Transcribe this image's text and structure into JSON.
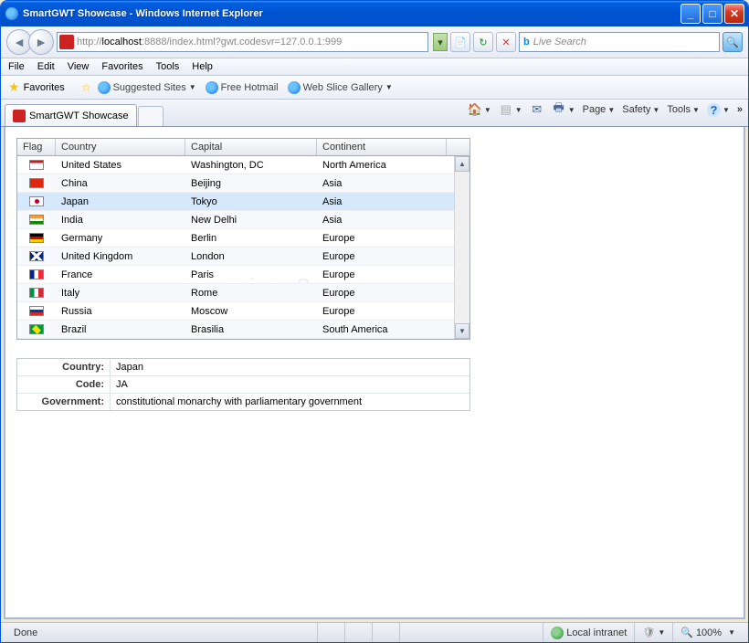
{
  "window": {
    "title": "SmartGWT Showcase - Windows Internet Explorer"
  },
  "address": {
    "prefix": "http://",
    "host": "localhost",
    "suffix": ":8888/index.html?gwt.codesvr=127.0.0.1:999"
  },
  "toolbar": {
    "refresh": "↻",
    "stop": "✕"
  },
  "search": {
    "placeholder": "Live Search"
  },
  "menu": {
    "file": "File",
    "edit": "Edit",
    "view": "View",
    "favorites": "Favorites",
    "tools": "Tools",
    "help": "Help"
  },
  "fav": {
    "label": "Favorites",
    "suggested": "Suggested Sites",
    "hotmail": "Free Hotmail",
    "webslice": "Web Slice Gallery"
  },
  "tab": {
    "title": "SmartGWT Showcase"
  },
  "cmd": {
    "page": "Page",
    "safety": "Safety",
    "tools": "Tools"
  },
  "grid": {
    "headers": {
      "flag": "Flag",
      "country": "Country",
      "capital": "Capital",
      "continent": "Continent"
    },
    "rows": [
      {
        "flag": "f-us",
        "country": "United States",
        "capital": "Washington, DC",
        "continent": "North America"
      },
      {
        "flag": "f-cn",
        "country": "China",
        "capital": "Beijing",
        "continent": "Asia"
      },
      {
        "flag": "f-jp",
        "country": "Japan",
        "capital": "Tokyo",
        "continent": "Asia",
        "selected": true
      },
      {
        "flag": "f-in",
        "country": "India",
        "capital": "New Delhi",
        "continent": "Asia"
      },
      {
        "flag": "f-de",
        "country": "Germany",
        "capital": "Berlin",
        "continent": "Europe"
      },
      {
        "flag": "f-uk",
        "country": "United Kingdom",
        "capital": "London",
        "continent": "Europe"
      },
      {
        "flag": "f-fr",
        "country": "France",
        "capital": "Paris",
        "continent": "Europe"
      },
      {
        "flag": "f-it",
        "country": "Italy",
        "capital": "Rome",
        "continent": "Europe"
      },
      {
        "flag": "f-ru",
        "country": "Russia",
        "capital": "Moscow",
        "continent": "Europe"
      },
      {
        "flag": "f-br",
        "country": "Brazil",
        "capital": "Brasilia",
        "continent": "South America"
      }
    ]
  },
  "detail": {
    "labels": {
      "country": "Country:",
      "code": "Code:",
      "government": "Government:"
    },
    "values": {
      "country": "Japan",
      "code": "JA",
      "government": "constitutional monarchy with parliamentary government"
    }
  },
  "status": {
    "done": "Done",
    "zone": "Local intranet",
    "zoom": "100%"
  }
}
